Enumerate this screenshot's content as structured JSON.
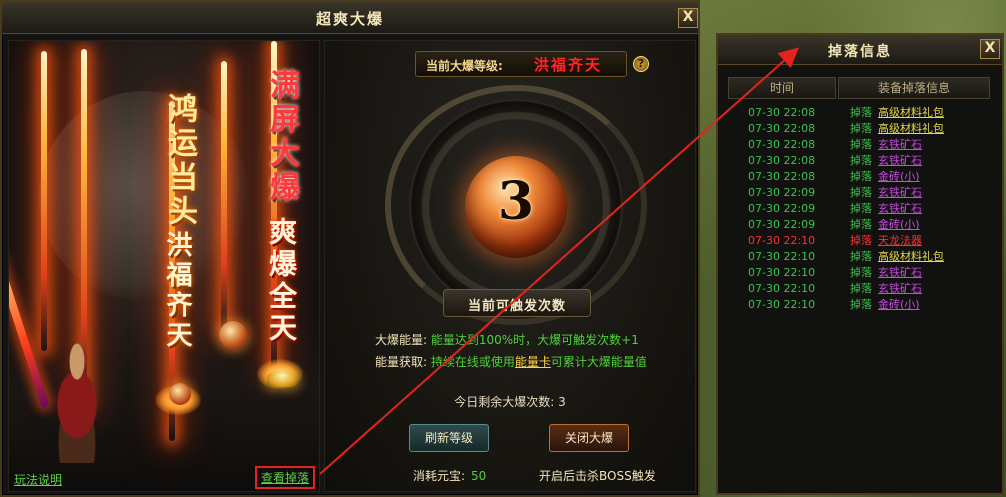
{
  "main_window": {
    "title": "超爽大爆",
    "close_label": "X"
  },
  "art": {
    "col_gold": "鸿运当头",
    "col_white": "洪福齐天",
    "col_red": "满屏大爆",
    "col_white2": "爽爆全天",
    "help_link": "玩法说明",
    "drop_link": "查看掉落"
  },
  "panel": {
    "level_label": "当前大爆等级:",
    "level_value": "洪福齐天",
    "help_icon": "?",
    "trigger_count": "3",
    "trigger_label": "当前可触发次数",
    "energy_key": "大爆能量:",
    "energy_value": "能量达到100%时，大爆可触发次数+1",
    "gain_key": "能量获取:",
    "gain_value_pre": "持续在线或使用",
    "gain_value_item": "能量卡",
    "gain_value_post": "可累计大爆能量值",
    "remaining": "今日剩余大爆次数: 3",
    "refresh_button": "刷新等级",
    "close_button": "关闭大爆",
    "cost_label": "消耗元宝:",
    "cost_value": "50",
    "boss_note": "开启后击杀BOSS触发"
  },
  "drop_window": {
    "title": "掉落信息",
    "close_label": "X",
    "col_time": "时间",
    "col_info": "装备掉落信息",
    "rows": [
      {
        "time": "07-30  22:08",
        "act": "掉落",
        "item": "高级材料礼包",
        "color": "#e6d84a"
      },
      {
        "time": "07-30  22:08",
        "act": "掉落",
        "item": "高级材料礼包",
        "color": "#e6d84a"
      },
      {
        "time": "07-30  22:08",
        "act": "掉落",
        "item": "玄铁矿石",
        "color": "#c84ae0"
      },
      {
        "time": "07-30  22:08",
        "act": "掉落",
        "item": "玄铁矿石",
        "color": "#c84ae0"
      },
      {
        "time": "07-30  22:08",
        "act": "掉落",
        "item": "金砖(小)",
        "color": "#c84ae0"
      },
      {
        "time": "07-30  22:09",
        "act": "掉落",
        "item": "玄铁矿石",
        "color": "#c84ae0"
      },
      {
        "time": "07-30  22:09",
        "act": "掉落",
        "item": "玄铁矿石",
        "color": "#c84ae0"
      },
      {
        "time": "07-30  22:09",
        "act": "掉落",
        "item": "金砖(小)",
        "color": "#c84ae0"
      },
      {
        "time": "07-30  22:10",
        "act": "掉落",
        "item": "天龙法器",
        "color": "#ff3030",
        "time_color": "#ff3030",
        "act_color": "#ff3030"
      },
      {
        "time": "07-30  22:10",
        "act": "掉落",
        "item": "高级材料礼包",
        "color": "#e6d84a"
      },
      {
        "time": "07-30  22:10",
        "act": "掉落",
        "item": "玄铁矿石",
        "color": "#c84ae0"
      },
      {
        "time": "07-30  22:10",
        "act": "掉落",
        "item": "玄铁矿石",
        "color": "#c84ae0"
      },
      {
        "time": "07-30  22:10",
        "act": "掉落",
        "item": "金砖(小)",
        "color": "#c84ae0"
      }
    ]
  }
}
